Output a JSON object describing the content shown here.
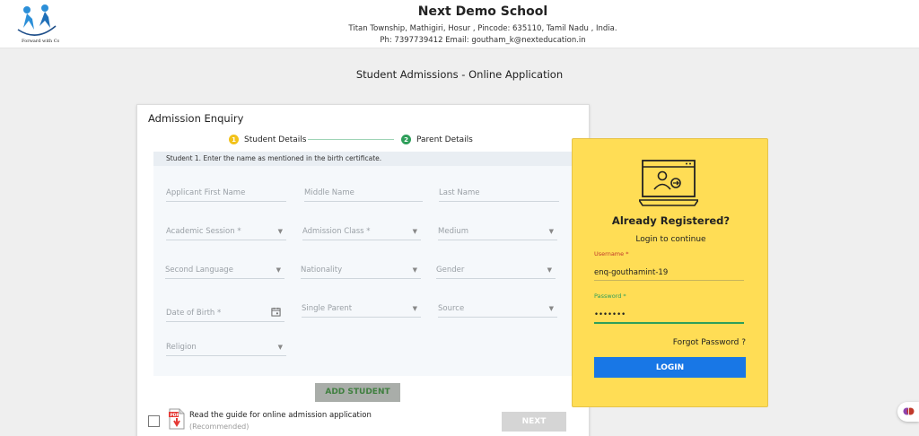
{
  "header": {
    "school_name": "Next Demo School",
    "address": "Titan Township, Mathigiri, Hosur , Pincode: 635110, Tamil Nadu , India.",
    "contact": "Ph: 7397739412 Email: goutham_k@nexteducation.in",
    "logo_icon": "school-logo-icon"
  },
  "page_title": "Student Admissions - Online Application",
  "enquiry": {
    "title": "Admission Enquiry",
    "steps": [
      {
        "num": "1",
        "label": "Student Details",
        "color": "#f2c21a"
      },
      {
        "num": "2",
        "label": "Parent Details",
        "color": "#2e9e5a"
      }
    ],
    "note": "Student 1. Enter the name as mentioned in the birth certificate.",
    "fields": {
      "first_name": "Applicant First Name",
      "middle_name": "Middle Name",
      "last_name": "Last Name",
      "academic_session": "Academic Session *",
      "admission_class": "Admission Class *",
      "medium": "Medium",
      "second_language": "Second Language",
      "nationality": "Nationality",
      "gender": "Gender",
      "dob": "Date of Birth *",
      "single_parent": "Single Parent",
      "source": "Source",
      "religion": "Religion"
    },
    "add_student_label": "ADD STUDENT",
    "guide_text": "Read the guide for online admission application",
    "recommended": "(Recommended)",
    "next_label": "NEXT"
  },
  "login": {
    "title": "Already Registered?",
    "subtitle": "Login to continue",
    "username_label": "Username *",
    "username_value": "enq-gouthamint-19",
    "password_label": "Password *",
    "password_value": "goutham",
    "forgot_label": "Forgot Password ?",
    "login_label": "LOGIN",
    "accent": "#ffdd55",
    "button_color": "#1877e6"
  }
}
